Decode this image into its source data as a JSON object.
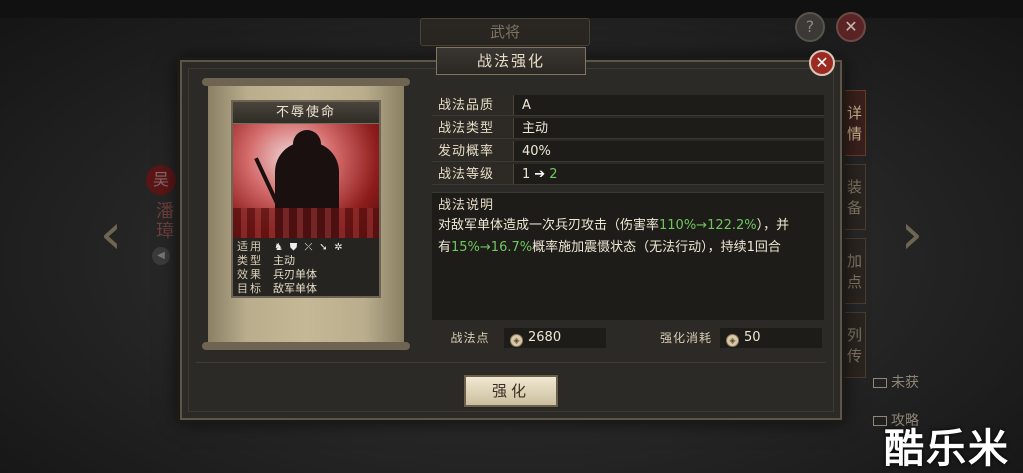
{
  "background": {
    "screen_title": "武将",
    "help_label": "?",
    "close_label": "✕",
    "general": {
      "faction_seal": "吴",
      "name": "潘璋"
    },
    "tabs": [
      {
        "label": "详情",
        "active": true
      },
      {
        "label": "装备",
        "active": false
      },
      {
        "label": "加点",
        "active": false
      },
      {
        "label": "列传",
        "active": false
      }
    ],
    "links": [
      "未获",
      "攻略"
    ]
  },
  "modal": {
    "title": "战法强化",
    "close_label": "✕",
    "card": {
      "name": "不辱使命",
      "rows": [
        {
          "key": "适用",
          "value": ""
        },
        {
          "key": "类型",
          "value": "主动"
        },
        {
          "key": "效果",
          "value": "兵刃单体"
        },
        {
          "key": "目标",
          "value": "敌军单体"
        }
      ],
      "arm_icons": [
        "cavalry-icon",
        "shield-icon",
        "archer-icon",
        "spear-icon",
        "siege-icon"
      ]
    },
    "info": {
      "quality_label": "战法品质",
      "quality": "A",
      "type_label": "战法类型",
      "type": "主动",
      "rate_label": "发动概率",
      "rate": "40%",
      "level_label": "战法等级",
      "level_from": "1",
      "level_arrow": "➔",
      "level_to": "2"
    },
    "description": {
      "label": "战法说明",
      "line1_a": "对敌军单体造成一次兵刃攻击（伤害率",
      "line1_g": "110%→122.2%",
      "line1_b": "），并",
      "line2_a": "有",
      "line2_g": "15%→16.7%",
      "line2_b": "概率施加震慑状态（无法行动），持续1回合"
    },
    "points_label": "战法点",
    "points": "2680",
    "cost_label": "强化消耗",
    "cost": "50",
    "upgrade_button": "强化"
  },
  "watermark": "酷乐米",
  "colors": {
    "accent_green": "#6ec75d",
    "close_red": "#9b2b22",
    "panel": "#2b2a26"
  }
}
